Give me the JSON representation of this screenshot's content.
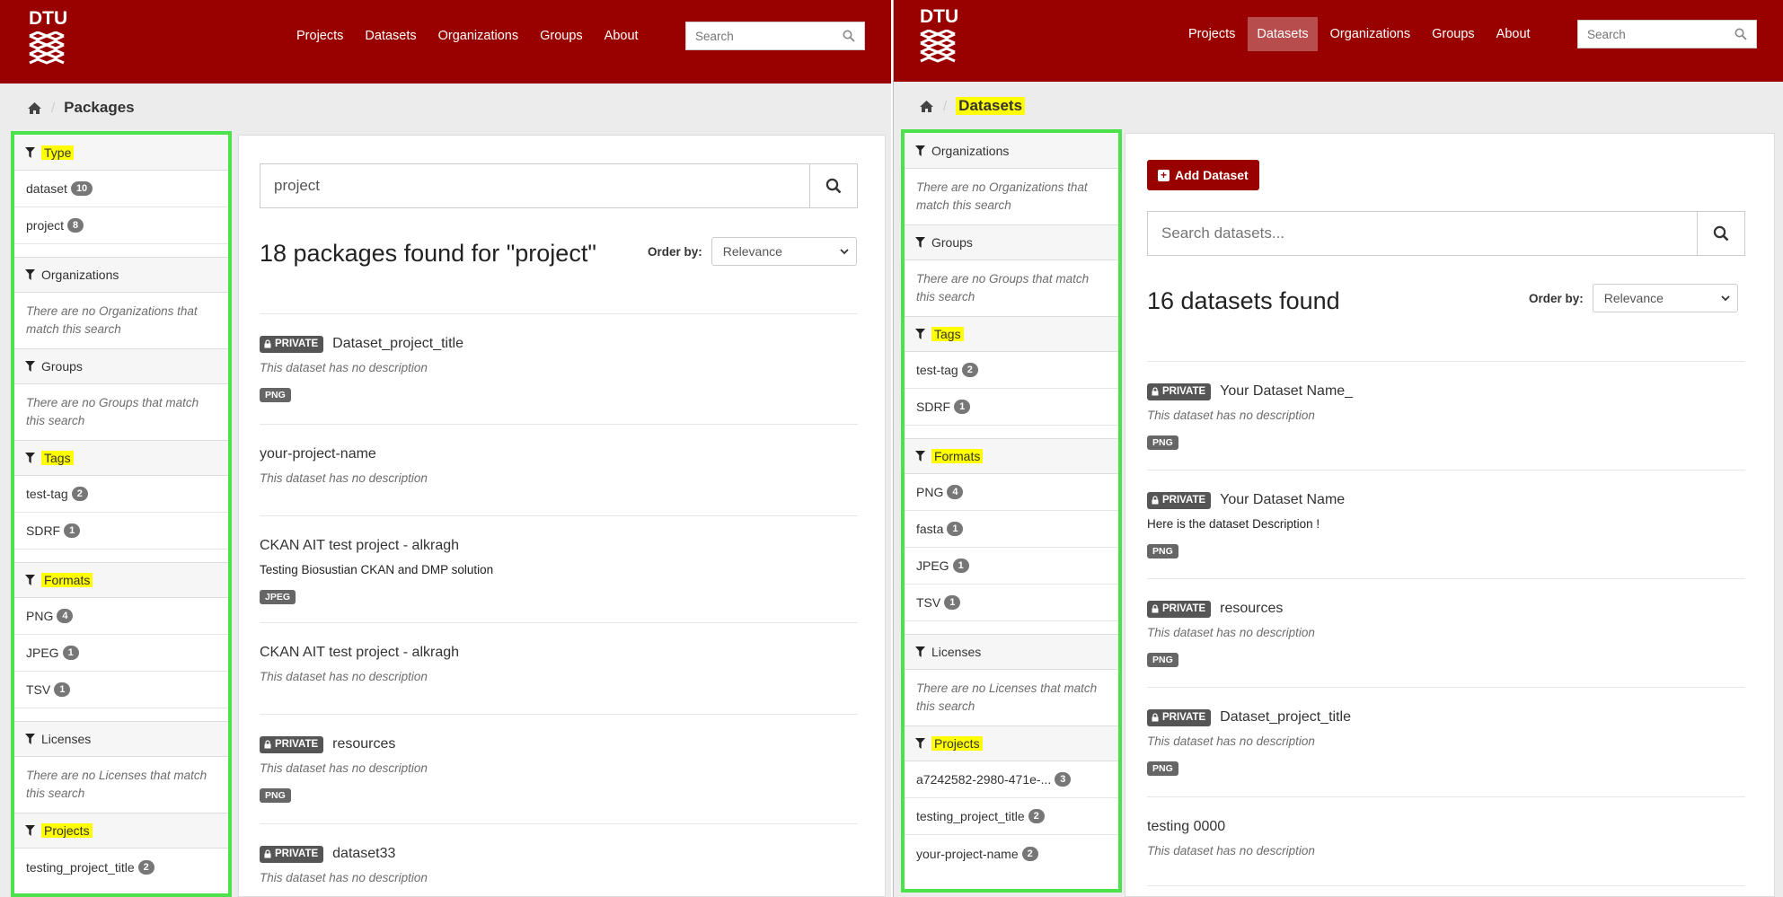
{
  "left": {
    "logo": "DTU",
    "nav": [
      "Projects",
      "Datasets",
      "Organizations",
      "Groups",
      "About"
    ],
    "search_placeholder": "Search",
    "breadcrumb": "Packages",
    "facets": {
      "type": {
        "title": "Type",
        "items": [
          {
            "label": "dataset",
            "count": "10"
          },
          {
            "label": "project",
            "count": "8"
          }
        ]
      },
      "organizations": {
        "title": "Organizations",
        "empty": "There are no Organizations that match this search"
      },
      "groups": {
        "title": "Groups",
        "empty": "There are no Groups that match this search"
      },
      "tags": {
        "title": "Tags",
        "items": [
          {
            "label": "test-tag",
            "count": "2"
          },
          {
            "label": "SDRF",
            "count": "1"
          }
        ]
      },
      "formats": {
        "title": "Formats",
        "items": [
          {
            "label": "PNG",
            "count": "4"
          },
          {
            "label": "JPEG",
            "count": "1"
          },
          {
            "label": "TSV",
            "count": "1"
          }
        ]
      },
      "licenses": {
        "title": "Licenses",
        "empty": "There are no Licenses that match this search"
      },
      "projects": {
        "title": "Projects",
        "items": [
          {
            "label": "testing_project_title",
            "count": "2"
          }
        ]
      }
    },
    "query": "project",
    "count_title": "18 packages found for \"project\"",
    "order_label": "Order by:",
    "order_value": "Relevance",
    "private_label": "PRIVATE",
    "results": [
      {
        "private": true,
        "title": "Dataset_project_title",
        "desc": "This dataset has no description",
        "desc_italic": true,
        "format": "PNG"
      },
      {
        "private": false,
        "title": "your-project-name",
        "desc": "This dataset has no description",
        "desc_italic": true,
        "format": ""
      },
      {
        "private": false,
        "title": "CKAN AIT test project - alkragh",
        "desc": "Testing Biosustian CKAN and DMP solution",
        "desc_italic": false,
        "format": "JPEG"
      },
      {
        "private": false,
        "title": "CKAN AIT test project - alkragh",
        "desc": "This dataset has no description",
        "desc_italic": true,
        "format": ""
      },
      {
        "private": true,
        "title": "resources",
        "desc": "This dataset has no description",
        "desc_italic": true,
        "format": "PNG"
      },
      {
        "private": true,
        "title": "dataset33",
        "desc": "This dataset has no description",
        "desc_italic": true,
        "format": ""
      }
    ]
  },
  "right": {
    "logo": "DTU",
    "nav": [
      "Projects",
      "Datasets",
      "Organizations",
      "Groups",
      "About"
    ],
    "nav_active": "Datasets",
    "search_placeholder": "Search",
    "breadcrumb": "Datasets",
    "facets": {
      "organizations": {
        "title": "Organizations",
        "empty": "There are no Organizations that match this search"
      },
      "groups": {
        "title": "Groups",
        "empty": "There are no Groups that match this search"
      },
      "tags": {
        "title": "Tags",
        "items": [
          {
            "label": "test-tag",
            "count": "2"
          },
          {
            "label": "SDRF",
            "count": "1"
          }
        ]
      },
      "formats": {
        "title": "Formats",
        "items": [
          {
            "label": "PNG",
            "count": "4"
          },
          {
            "label": "fasta",
            "count": "1"
          },
          {
            "label": "JPEG",
            "count": "1"
          },
          {
            "label": "TSV",
            "count": "1"
          }
        ]
      },
      "licenses": {
        "title": "Licenses",
        "empty": "There are no Licenses that match this search"
      },
      "projects": {
        "title": "Projects",
        "items": [
          {
            "label": "a7242582-2980-471e-...",
            "count": "3"
          },
          {
            "label": "testing_project_title",
            "count": "2"
          },
          {
            "label": "your-project-name",
            "count": "2"
          }
        ]
      }
    },
    "add_button": "Add Dataset",
    "search_placeholder_main": "Search datasets...",
    "count_title": "16 datasets found",
    "order_label": "Order by:",
    "order_value": "Relevance",
    "private_label": "PRIVATE",
    "results": [
      {
        "private": true,
        "title": "Your Dataset Name_",
        "desc": "This dataset has no description",
        "desc_italic": true,
        "format": "PNG"
      },
      {
        "private": true,
        "title": "Your Dataset Name",
        "desc": "Here is the dataset Description !",
        "desc_italic": false,
        "format": "PNG"
      },
      {
        "private": true,
        "title": "resources",
        "desc": "This dataset has no description",
        "desc_italic": true,
        "format": "PNG"
      },
      {
        "private": true,
        "title": "Dataset_project_title",
        "desc": "This dataset has no description",
        "desc_italic": true,
        "format": "PNG"
      },
      {
        "private": false,
        "title": "testing 0000",
        "desc": "This dataset has no description",
        "desc_italic": true,
        "format": ""
      }
    ]
  }
}
